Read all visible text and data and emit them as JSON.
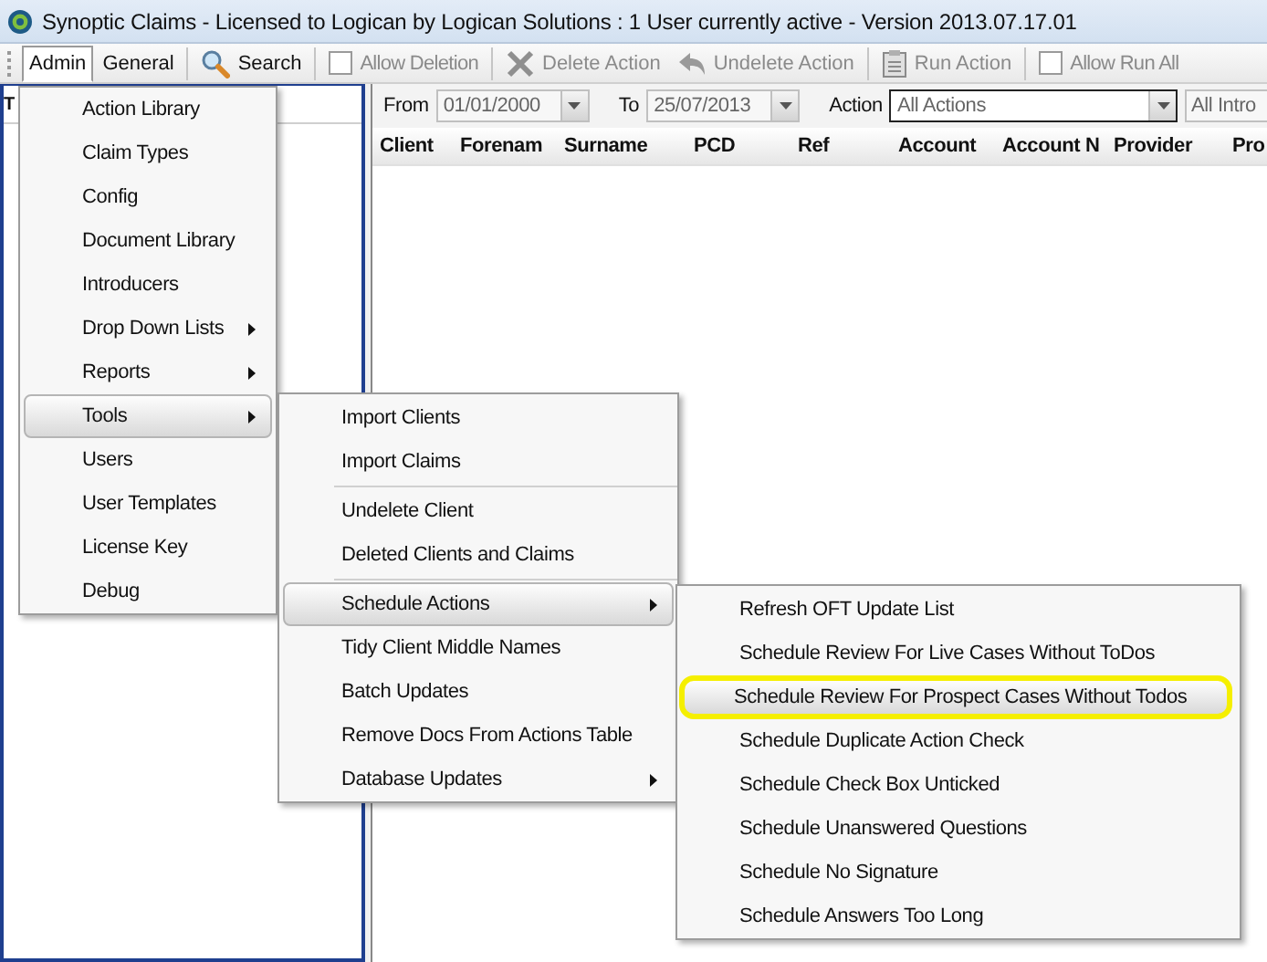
{
  "window": {
    "title": "Synoptic Claims - Licensed to Logican by Logican Solutions : 1 User currently active - Version 2013.07.17.01"
  },
  "toolbar": [
    {
      "kind": "tab",
      "label": "Admin",
      "selected": true
    },
    {
      "kind": "tab",
      "label": "General",
      "selected": false
    },
    {
      "kind": "search",
      "label": "Search",
      "disabled": false
    },
    {
      "kind": "checkbox",
      "label": "Allow Deletion",
      "checked": false,
      "disabled": true
    },
    {
      "kind": "delete",
      "label": "Delete Action",
      "disabled": true
    },
    {
      "kind": "undelete",
      "label": "Undelete Action",
      "disabled": true
    },
    {
      "kind": "run",
      "label": "Run Action",
      "disabled": true
    },
    {
      "kind": "checkbox",
      "label": "Allow Run All",
      "checked": false,
      "disabled": true
    }
  ],
  "left_panel": {
    "header": "T"
  },
  "filters": {
    "from_label": "From",
    "from_value": "01/01/2000",
    "to_label": "To",
    "to_value": "25/07/2013",
    "action_label": "Action",
    "action_value": "All Actions",
    "introducer_value": "All Intro"
  },
  "columns": [
    "Client",
    "Forenam",
    "Surname",
    "PCD",
    "Ref",
    "Account",
    "Account N",
    "Provider",
    "Pro"
  ],
  "admin_menu": [
    {
      "kind": "item",
      "label": "Action Library",
      "submenu": false,
      "highlighted": false
    },
    {
      "kind": "item",
      "label": "Claim Types",
      "submenu": false,
      "highlighted": false
    },
    {
      "kind": "item",
      "label": "Config",
      "submenu": false,
      "highlighted": false
    },
    {
      "kind": "item",
      "label": "Document Library",
      "submenu": false,
      "highlighted": false
    },
    {
      "kind": "item",
      "label": "Introducers",
      "submenu": false,
      "highlighted": false
    },
    {
      "kind": "item",
      "label": "Drop Down Lists",
      "submenu": true,
      "highlighted": false
    },
    {
      "kind": "item",
      "label": "Reports",
      "submenu": true,
      "highlighted": false
    },
    {
      "kind": "item",
      "label": "Tools",
      "submenu": true,
      "highlighted": true
    },
    {
      "kind": "item",
      "label": "Users",
      "submenu": false,
      "highlighted": false
    },
    {
      "kind": "item",
      "label": "User Templates",
      "submenu": false,
      "highlighted": false
    },
    {
      "kind": "item",
      "label": "License Key",
      "submenu": false,
      "highlighted": false
    },
    {
      "kind": "item",
      "label": "Debug",
      "submenu": false,
      "highlighted": false
    }
  ],
  "tools_menu": [
    {
      "kind": "item",
      "label": "Import Clients",
      "submenu": false,
      "highlighted": false
    },
    {
      "kind": "item",
      "label": "Import Claims",
      "submenu": false,
      "highlighted": false
    },
    {
      "kind": "separator"
    },
    {
      "kind": "item",
      "label": "Undelete Client",
      "submenu": false,
      "highlighted": false
    },
    {
      "kind": "item",
      "label": "Deleted Clients and Claims",
      "submenu": false,
      "highlighted": false
    },
    {
      "kind": "separator"
    },
    {
      "kind": "item",
      "label": "Schedule Actions",
      "submenu": true,
      "highlighted": true
    },
    {
      "kind": "item",
      "label": "Tidy Client Middle Names",
      "submenu": false,
      "highlighted": false
    },
    {
      "kind": "item",
      "label": "Batch Updates",
      "submenu": false,
      "highlighted": false
    },
    {
      "kind": "item",
      "label": "Remove Docs From Actions Table",
      "submenu": false,
      "highlighted": false
    },
    {
      "kind": "item",
      "label": "Database Updates",
      "submenu": true,
      "highlighted": false
    }
  ],
  "schedule_menu": [
    {
      "kind": "item",
      "label": "Refresh OFT Update List",
      "highlighted": false,
      "circled": false
    },
    {
      "kind": "item",
      "label": "Schedule Review For Live Cases Without ToDos",
      "highlighted": false,
      "circled": false
    },
    {
      "kind": "item",
      "label": "Schedule Review For Prospect Cases Without Todos",
      "highlighted": true,
      "circled": true
    },
    {
      "kind": "item",
      "label": "Schedule Duplicate Action Check",
      "highlighted": false,
      "circled": false
    },
    {
      "kind": "item",
      "label": "Schedule Check Box Unticked",
      "highlighted": false,
      "circled": false
    },
    {
      "kind": "item",
      "label": "Schedule Unanswered Questions",
      "highlighted": false,
      "circled": false
    },
    {
      "kind": "item",
      "label": "Schedule No Signature",
      "highlighted": false,
      "circled": false
    },
    {
      "kind": "item",
      "label": "Schedule Answers Too Long",
      "highlighted": false,
      "circled": false
    }
  ]
}
